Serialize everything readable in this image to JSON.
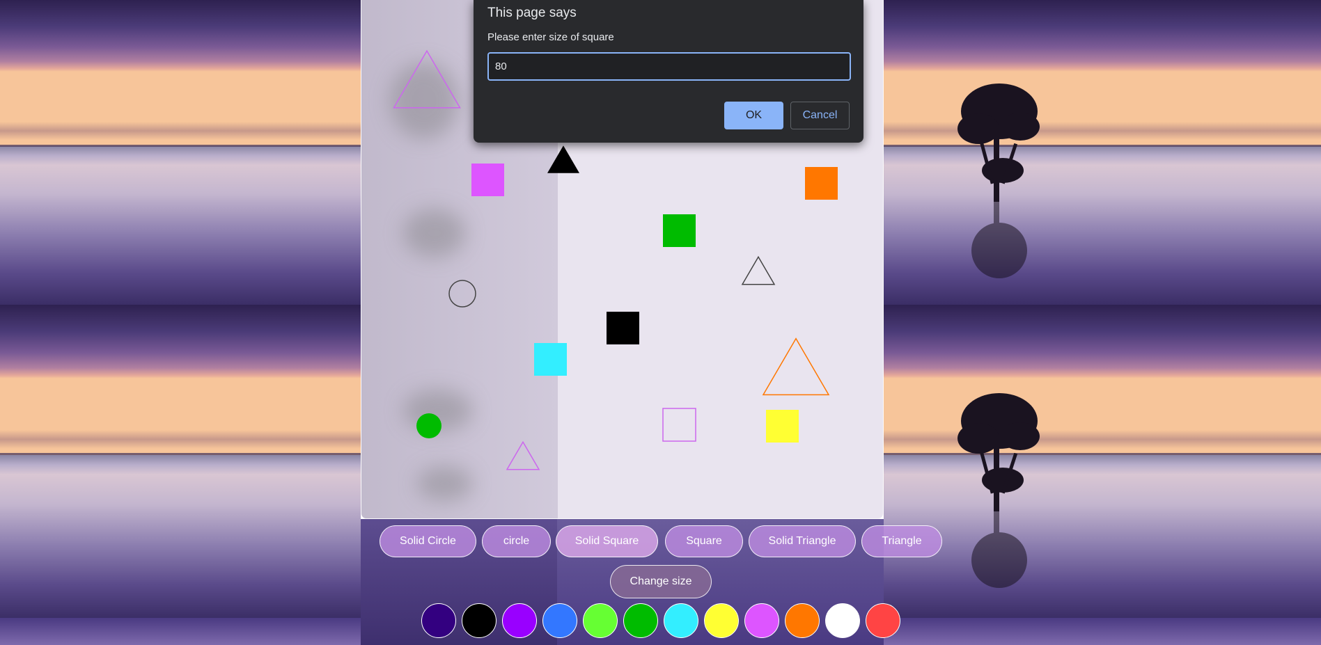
{
  "dialog": {
    "title": "This page says",
    "message": "Please enter size of square",
    "input_value": "80",
    "ok_label": "OK",
    "cancel_label": "Cancel"
  },
  "shape_buttons": [
    {
      "label": "Solid Circle"
    },
    {
      "label": "circle"
    },
    {
      "label": "Solid Square"
    },
    {
      "label": "Square"
    },
    {
      "label": "Solid Triangle"
    },
    {
      "label": "Triangle"
    }
  ],
  "change_size_label": "Change size",
  "palette": [
    "#330080",
    "#000000",
    "#9900ff",
    "#3377ff",
    "#66ff33",
    "#00bb00",
    "#33eeff",
    "#ffff33",
    "#dd55ff",
    "#ff7700",
    "#ffffff",
    "#ff4444"
  ],
  "canvas_shapes": [
    {
      "type": "triangle",
      "fill": false,
      "color": "#cc66ee"
    },
    {
      "type": "square",
      "fill": true,
      "color": "#dd55ff"
    },
    {
      "type": "triangle",
      "fill": true,
      "color": "#000000"
    },
    {
      "type": "square",
      "fill": true,
      "color": "#ff7700"
    },
    {
      "type": "square",
      "fill": true,
      "color": "#00bb00"
    },
    {
      "type": "triangle",
      "fill": false,
      "color": "#444444"
    },
    {
      "type": "circle",
      "fill": false,
      "color": "#444444"
    },
    {
      "type": "square",
      "fill": true,
      "color": "#000000"
    },
    {
      "type": "square",
      "fill": true,
      "color": "#33eeff"
    },
    {
      "type": "triangle",
      "fill": false,
      "color": "#ff7700"
    },
    {
      "type": "circle",
      "fill": true,
      "color": "#00bb00"
    },
    {
      "type": "square",
      "fill": false,
      "color": "#cc66ee"
    },
    {
      "type": "square",
      "fill": true,
      "color": "#ffff33"
    },
    {
      "type": "triangle",
      "fill": false,
      "color": "#cc66ee"
    }
  ]
}
